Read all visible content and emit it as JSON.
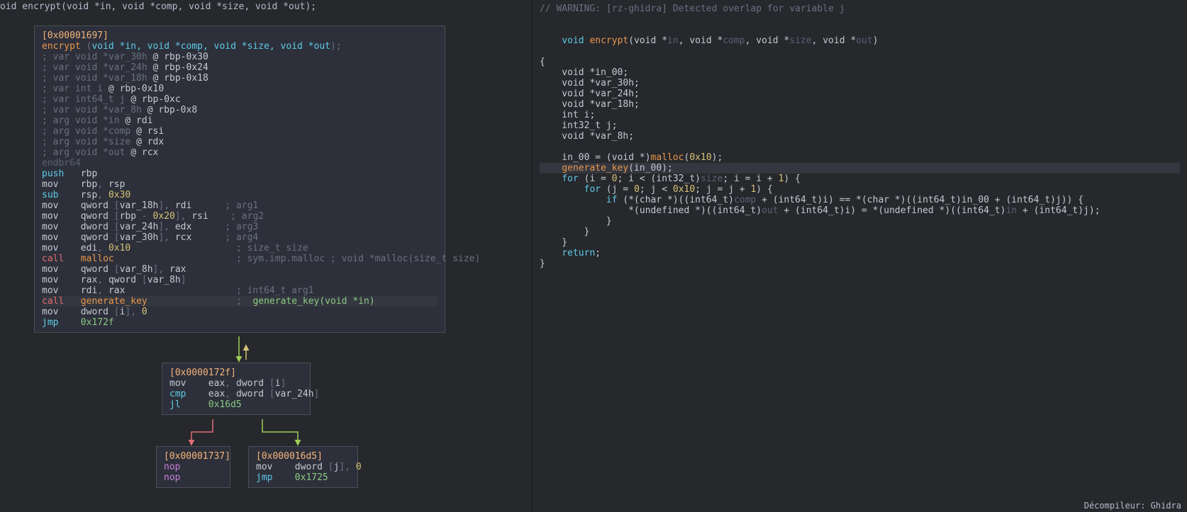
{
  "signature_bar": "oid encrypt(void *in, void *comp, void *size, void *out);",
  "graph": {
    "block1": {
      "addr": "[0x00001697]",
      "tokens": [
        {
          "t": "addr",
          "s": "[0x00001697]\n"
        },
        {
          "t": "orange",
          "s": "encrypt "
        },
        {
          "t": "gray",
          "s": "("
        },
        {
          "t": "cyan",
          "s": "void *in, void *comp, void *size, void *out"
        },
        {
          "t": "gray",
          "s": ");\n"
        },
        {
          "t": "gray",
          "s": "; var void *var_30h "
        },
        {
          "t": "white",
          "s": "@ rbp-0x30\n"
        },
        {
          "t": "gray",
          "s": "; var void *var_24h "
        },
        {
          "t": "white",
          "s": "@ rbp-0x24\n"
        },
        {
          "t": "gray",
          "s": "; var void *var_18h "
        },
        {
          "t": "white",
          "s": "@ rbp-0x18\n"
        },
        {
          "t": "gray",
          "s": "; var int i "
        },
        {
          "t": "white",
          "s": "@ rbp-0x10\n"
        },
        {
          "t": "gray",
          "s": "; var int64_t j "
        },
        {
          "t": "white",
          "s": "@ rbp-0xc\n"
        },
        {
          "t": "gray",
          "s": "; var void *var_8h "
        },
        {
          "t": "white",
          "s": "@ rbp-0x8\n"
        },
        {
          "t": "gray",
          "s": "; arg void *in "
        },
        {
          "t": "white",
          "s": "@ rdi\n"
        },
        {
          "t": "gray",
          "s": "; arg void *comp "
        },
        {
          "t": "white",
          "s": "@ rsi\n"
        },
        {
          "t": "gray",
          "s": "; arg void *size "
        },
        {
          "t": "white",
          "s": "@ rdx\n"
        },
        {
          "t": "gray",
          "s": "; arg void *out "
        },
        {
          "t": "white",
          "s": "@ rcx\n"
        },
        {
          "t": "dim",
          "s": "endbr64\n"
        },
        {
          "t": "cyan",
          "s": "push"
        },
        {
          "t": "white",
          "s": "   rbp\n"
        },
        {
          "t": "white",
          "s": "mov    rbp"
        },
        {
          "t": "gray",
          "s": ", "
        },
        {
          "t": "white",
          "s": "rsp\n"
        },
        {
          "t": "cyan",
          "s": "sub"
        },
        {
          "t": "white",
          "s": "    rsp"
        },
        {
          "t": "gray",
          "s": ", "
        },
        {
          "t": "yellow",
          "s": "0x30\n"
        },
        {
          "t": "white",
          "s": "mov    qword "
        },
        {
          "t": "gray",
          "s": "["
        },
        {
          "t": "white",
          "s": "var_18h"
        },
        {
          "t": "gray",
          "s": "], "
        },
        {
          "t": "white",
          "s": "rdi"
        },
        {
          "t": "gray",
          "s": "      ; arg1\n"
        },
        {
          "t": "white",
          "s": "mov    qword "
        },
        {
          "t": "gray",
          "s": "["
        },
        {
          "t": "white",
          "s": "rbp "
        },
        {
          "t": "gray",
          "s": "- "
        },
        {
          "t": "yellow",
          "s": "0x20"
        },
        {
          "t": "gray",
          "s": "], "
        },
        {
          "t": "white",
          "s": "rsi"
        },
        {
          "t": "gray",
          "s": "    ; arg2\n"
        },
        {
          "t": "white",
          "s": "mov    dword "
        },
        {
          "t": "gray",
          "s": "["
        },
        {
          "t": "white",
          "s": "var_24h"
        },
        {
          "t": "gray",
          "s": "], "
        },
        {
          "t": "white",
          "s": "edx"
        },
        {
          "t": "gray",
          "s": "      ; arg3\n"
        },
        {
          "t": "white",
          "s": "mov    qword "
        },
        {
          "t": "gray",
          "s": "["
        },
        {
          "t": "white",
          "s": "var_30h"
        },
        {
          "t": "gray",
          "s": "], "
        },
        {
          "t": "white",
          "s": "rcx"
        },
        {
          "t": "gray",
          "s": "      ; arg4\n"
        },
        {
          "t": "white",
          "s": "mov    edi"
        },
        {
          "t": "gray",
          "s": ", "
        },
        {
          "t": "yellow",
          "s": "0x10"
        },
        {
          "t": "gray",
          "s": "                   ; size_t size\n"
        },
        {
          "t": "red",
          "s": "call"
        },
        {
          "t": "white",
          "s": "   "
        },
        {
          "t": "orange",
          "s": "malloc"
        },
        {
          "t": "gray",
          "s": "                      ; sym.imp.malloc ; void *malloc(size_t size)\n"
        },
        {
          "t": "white",
          "s": "mov    qword "
        },
        {
          "t": "gray",
          "s": "["
        },
        {
          "t": "white",
          "s": "var_8h"
        },
        {
          "t": "gray",
          "s": "], "
        },
        {
          "t": "white",
          "s": "rax\n"
        },
        {
          "t": "white",
          "s": "mov    rax"
        },
        {
          "t": "gray",
          "s": ", "
        },
        {
          "t": "white",
          "s": "qword "
        },
        {
          "t": "gray",
          "s": "["
        },
        {
          "t": "white",
          "s": "var_8h"
        },
        {
          "t": "gray",
          "s": "]\n"
        },
        {
          "t": "white",
          "s": "mov    rdi"
        },
        {
          "t": "gray",
          "s": ", "
        },
        {
          "t": "white",
          "s": "rax"
        },
        {
          "t": "gray",
          "s": "                    ; int64_t arg1\n"
        },
        {
          "hl": true,
          "t": "red",
          "s": "call"
        },
        {
          "t": "white",
          "s": "   "
        },
        {
          "t": "orange",
          "s": "generate_key"
        },
        {
          "t": "gray",
          "s": "                ;  "
        },
        {
          "t": "green",
          "s": "generate_key(void *in)\n"
        },
        {
          "t": "white",
          "s": "mov    dword "
        },
        {
          "t": "gray",
          "s": "["
        },
        {
          "t": "white",
          "s": "i"
        },
        {
          "t": "gray",
          "s": "], "
        },
        {
          "t": "yellow",
          "s": "0\n"
        },
        {
          "t": "cyan",
          "s": "jmp"
        },
        {
          "t": "white",
          "s": "    "
        },
        {
          "t": "green",
          "s": "0x172f"
        }
      ]
    },
    "block2": {
      "addr": "[0x0000172f]",
      "tokens": [
        {
          "t": "addr",
          "s": "[0x0000172f]\n"
        },
        {
          "t": "white",
          "s": "mov    eax"
        },
        {
          "t": "gray",
          "s": ", "
        },
        {
          "t": "white",
          "s": "dword "
        },
        {
          "t": "gray",
          "s": "["
        },
        {
          "t": "white",
          "s": "i"
        },
        {
          "t": "gray",
          "s": "]\n"
        },
        {
          "t": "cyan",
          "s": "cmp"
        },
        {
          "t": "white",
          "s": "    eax"
        },
        {
          "t": "gray",
          "s": ", "
        },
        {
          "t": "white",
          "s": "dword "
        },
        {
          "t": "gray",
          "s": "["
        },
        {
          "t": "white",
          "s": "var_24h"
        },
        {
          "t": "gray",
          "s": "]\n"
        },
        {
          "t": "cyan",
          "s": "jl"
        },
        {
          "t": "white",
          "s": "     "
        },
        {
          "t": "green",
          "s": "0x16d5"
        }
      ]
    },
    "block3": {
      "addr": "[0x00001737]",
      "tokens": [
        {
          "t": "addr",
          "s": "[0x00001737]\n"
        },
        {
          "t": "purple",
          "s": "nop\n"
        },
        {
          "t": "purple",
          "s": "nop"
        }
      ]
    },
    "block4": {
      "addr": "[0x000016d5]",
      "tokens": [
        {
          "t": "addr",
          "s": "[0x000016d5]\n"
        },
        {
          "t": "white",
          "s": "mov    dword "
        },
        {
          "t": "gray",
          "s": "["
        },
        {
          "t": "white",
          "s": "j"
        },
        {
          "t": "gray",
          "s": "], "
        },
        {
          "t": "yellow",
          "s": "0\n"
        },
        {
          "t": "cyan",
          "s": "jmp"
        },
        {
          "t": "white",
          "s": "    "
        },
        {
          "t": "green",
          "s": "0x1725"
        }
      ]
    }
  },
  "decomp": {
    "warn": "// WARNING: [rz-ghidra] Detected overlap for variable j",
    "sig_pre": "void ",
    "sig_fn": "encrypt",
    "sig_args": "(void *",
    "arg1": "in",
    "sig_mid1": ", void *",
    "arg2": "comp",
    "sig_mid2": ", void *",
    "arg3": "size",
    "sig_mid3": ", void *",
    "arg4": "out",
    "sig_end": ")",
    "decls": [
      "    void *in_00;",
      "    void *var_30h;",
      "    void *var_24h;",
      "    void *var_18h;",
      "    int i;",
      "    int32_t j;",
      "    void *var_8h;"
    ],
    "body": [
      [
        {
          "t": "white",
          "s": "    in_00 = (void *)"
        },
        {
          "t": "orange",
          "s": "malloc"
        },
        {
          "t": "white",
          "s": "("
        },
        {
          "t": "yellow",
          "s": "0x10"
        },
        {
          "t": "white",
          "s": ");"
        }
      ],
      [
        {
          "hl": true,
          "t": "white",
          "s": "    "
        },
        {
          "t": "orange",
          "s": "generate_key"
        },
        {
          "t": "white",
          "s": "(in_00);"
        }
      ],
      [
        {
          "t": "white",
          "s": "    "
        },
        {
          "t": "cyan",
          "s": "for"
        },
        {
          "t": "white",
          "s": " (i = "
        },
        {
          "t": "yellow",
          "s": "0"
        },
        {
          "t": "white",
          "s": "; i < (int32_t)"
        },
        {
          "t": "dim",
          "s": "size"
        },
        {
          "t": "white",
          "s": "; i = i + "
        },
        {
          "t": "yellow",
          "s": "1"
        },
        {
          "t": "white",
          "s": ") {"
        }
      ],
      [
        {
          "t": "white",
          "s": "        "
        },
        {
          "t": "cyan",
          "s": "for"
        },
        {
          "t": "white",
          "s": " (j = "
        },
        {
          "t": "yellow",
          "s": "0"
        },
        {
          "t": "white",
          "s": "; j < "
        },
        {
          "t": "yellow",
          "s": "0x10"
        },
        {
          "t": "white",
          "s": "; j = j + "
        },
        {
          "t": "yellow",
          "s": "1"
        },
        {
          "t": "white",
          "s": ") {"
        }
      ],
      [
        {
          "t": "white",
          "s": "            "
        },
        {
          "t": "cyan",
          "s": "if"
        },
        {
          "t": "white",
          "s": " (*(char *)((int64_t)"
        },
        {
          "t": "dim",
          "s": "comp"
        },
        {
          "t": "white",
          "s": " + (int64_t)i) == *(char *)((int64_t)in_00 + (int64_t)j)) {"
        }
      ],
      [
        {
          "t": "white",
          "s": "                *(undefined *)((int64_t)"
        },
        {
          "t": "dim",
          "s": "out"
        },
        {
          "t": "white",
          "s": " + (int64_t)i) = *(undefined *)((int64_t)"
        },
        {
          "t": "dim",
          "s": "in"
        },
        {
          "t": "white",
          "s": " + (int64_t)j);"
        }
      ],
      [
        {
          "t": "white",
          "s": "            }"
        }
      ],
      [
        {
          "t": "white",
          "s": "        }"
        }
      ],
      [
        {
          "t": "white",
          "s": "    }"
        }
      ],
      [
        {
          "t": "white",
          "s": "    "
        },
        {
          "t": "cyan",
          "s": "return"
        },
        {
          "t": "white",
          "s": ";"
        }
      ]
    ],
    "close": "}"
  },
  "footer": "Décompileur: Ghidra"
}
